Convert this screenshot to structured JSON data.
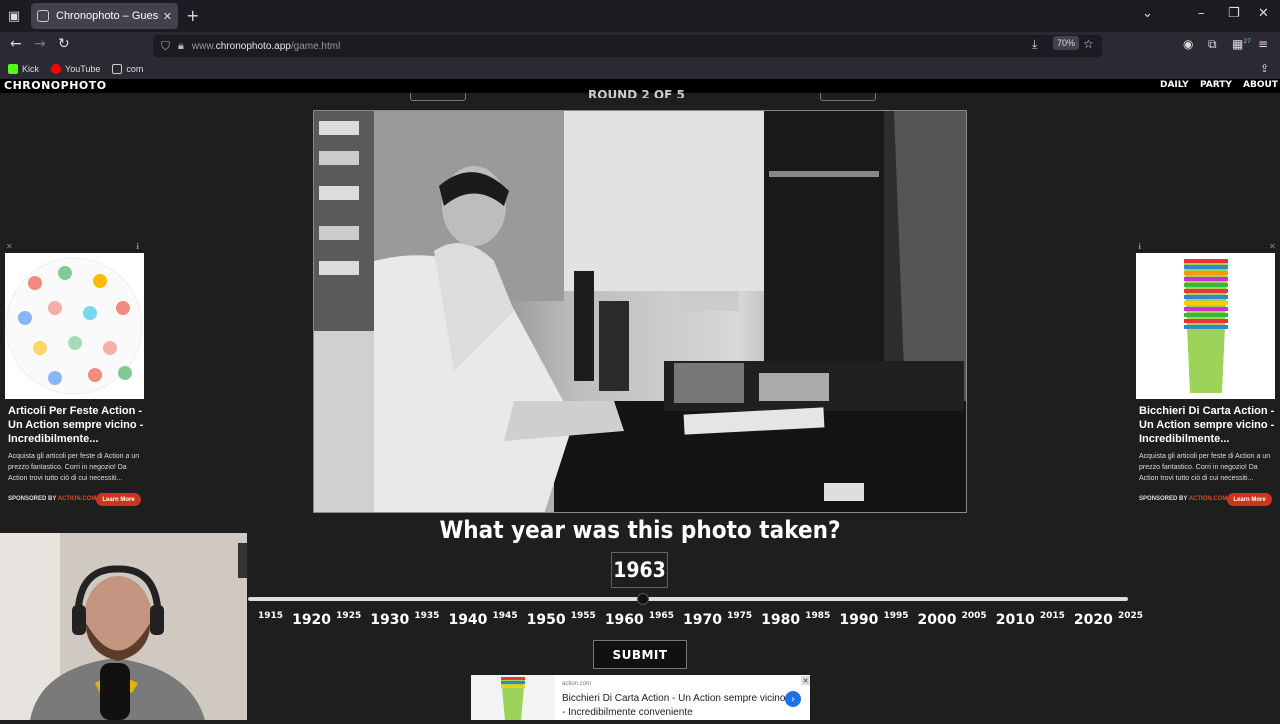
{
  "browser": {
    "tab_title": "Chronophoto – Guess the Year",
    "url_prefix": "www.",
    "url_domain": "chronophoto.app",
    "url_path": "/game.html",
    "zoom": "70%",
    "extension_badge": "27",
    "bookmarks": [
      {
        "label": "Kick",
        "color": "#53fc18"
      },
      {
        "label": "YouTube",
        "color": "#ff0000"
      },
      {
        "label": "com",
        "color": "#cccccc"
      }
    ]
  },
  "site": {
    "logo": "CHRONOPHOTO",
    "menu": [
      "DAILY",
      "PARTY",
      "ABOUT"
    ],
    "round_label": "ROUND 2 OF 5"
  },
  "game": {
    "question": "What year was this photo taken?",
    "selected_year": "1963",
    "slider_value": 1963,
    "slider_min": 1910,
    "slider_max": 2025,
    "ticks_major": [
      "1920",
      "1930",
      "1940",
      "1950",
      "1960",
      "1970",
      "1980",
      "1990",
      "2000",
      "2010",
      "2020"
    ],
    "ticks_minor": [
      "1915",
      "1925",
      "1935",
      "1945",
      "1955",
      "1965",
      "1975",
      "1985",
      "1995",
      "2005",
      "2015",
      "2025"
    ],
    "submit_label": "SUBMIT"
  },
  "ads": {
    "left": {
      "title": "Articoli Per Feste Action - Un Action sempre vicino - Incredibilmente...",
      "body": "Acquista gli articoli per feste di Action a un prezzo fantastico. Corri in negozio! Da Action trovi tutto ciò di cui necessiti...",
      "sponsor_prefix": "SPONSORED BY ",
      "sponsor": "ACTION.COM",
      "cta": "Learn More"
    },
    "right": {
      "title": "Bicchieri Di Carta Action - Un Action sempre vicino - Incredibilmente...",
      "body": "Acquista gli articoli per feste di Action a un prezzo fantastico. Corri in negozio! Da Action trovi tutto ciò di cui necessiti...",
      "sponsor_prefix": "SPONSORED BY ",
      "sponsor": "ACTION.COM",
      "cta": "Learn More"
    },
    "bottom": {
      "domain": "action.com",
      "text": "Bicchieri Di Carta Action - Un Action sempre vicino - Incredibilmente conveniente"
    }
  }
}
